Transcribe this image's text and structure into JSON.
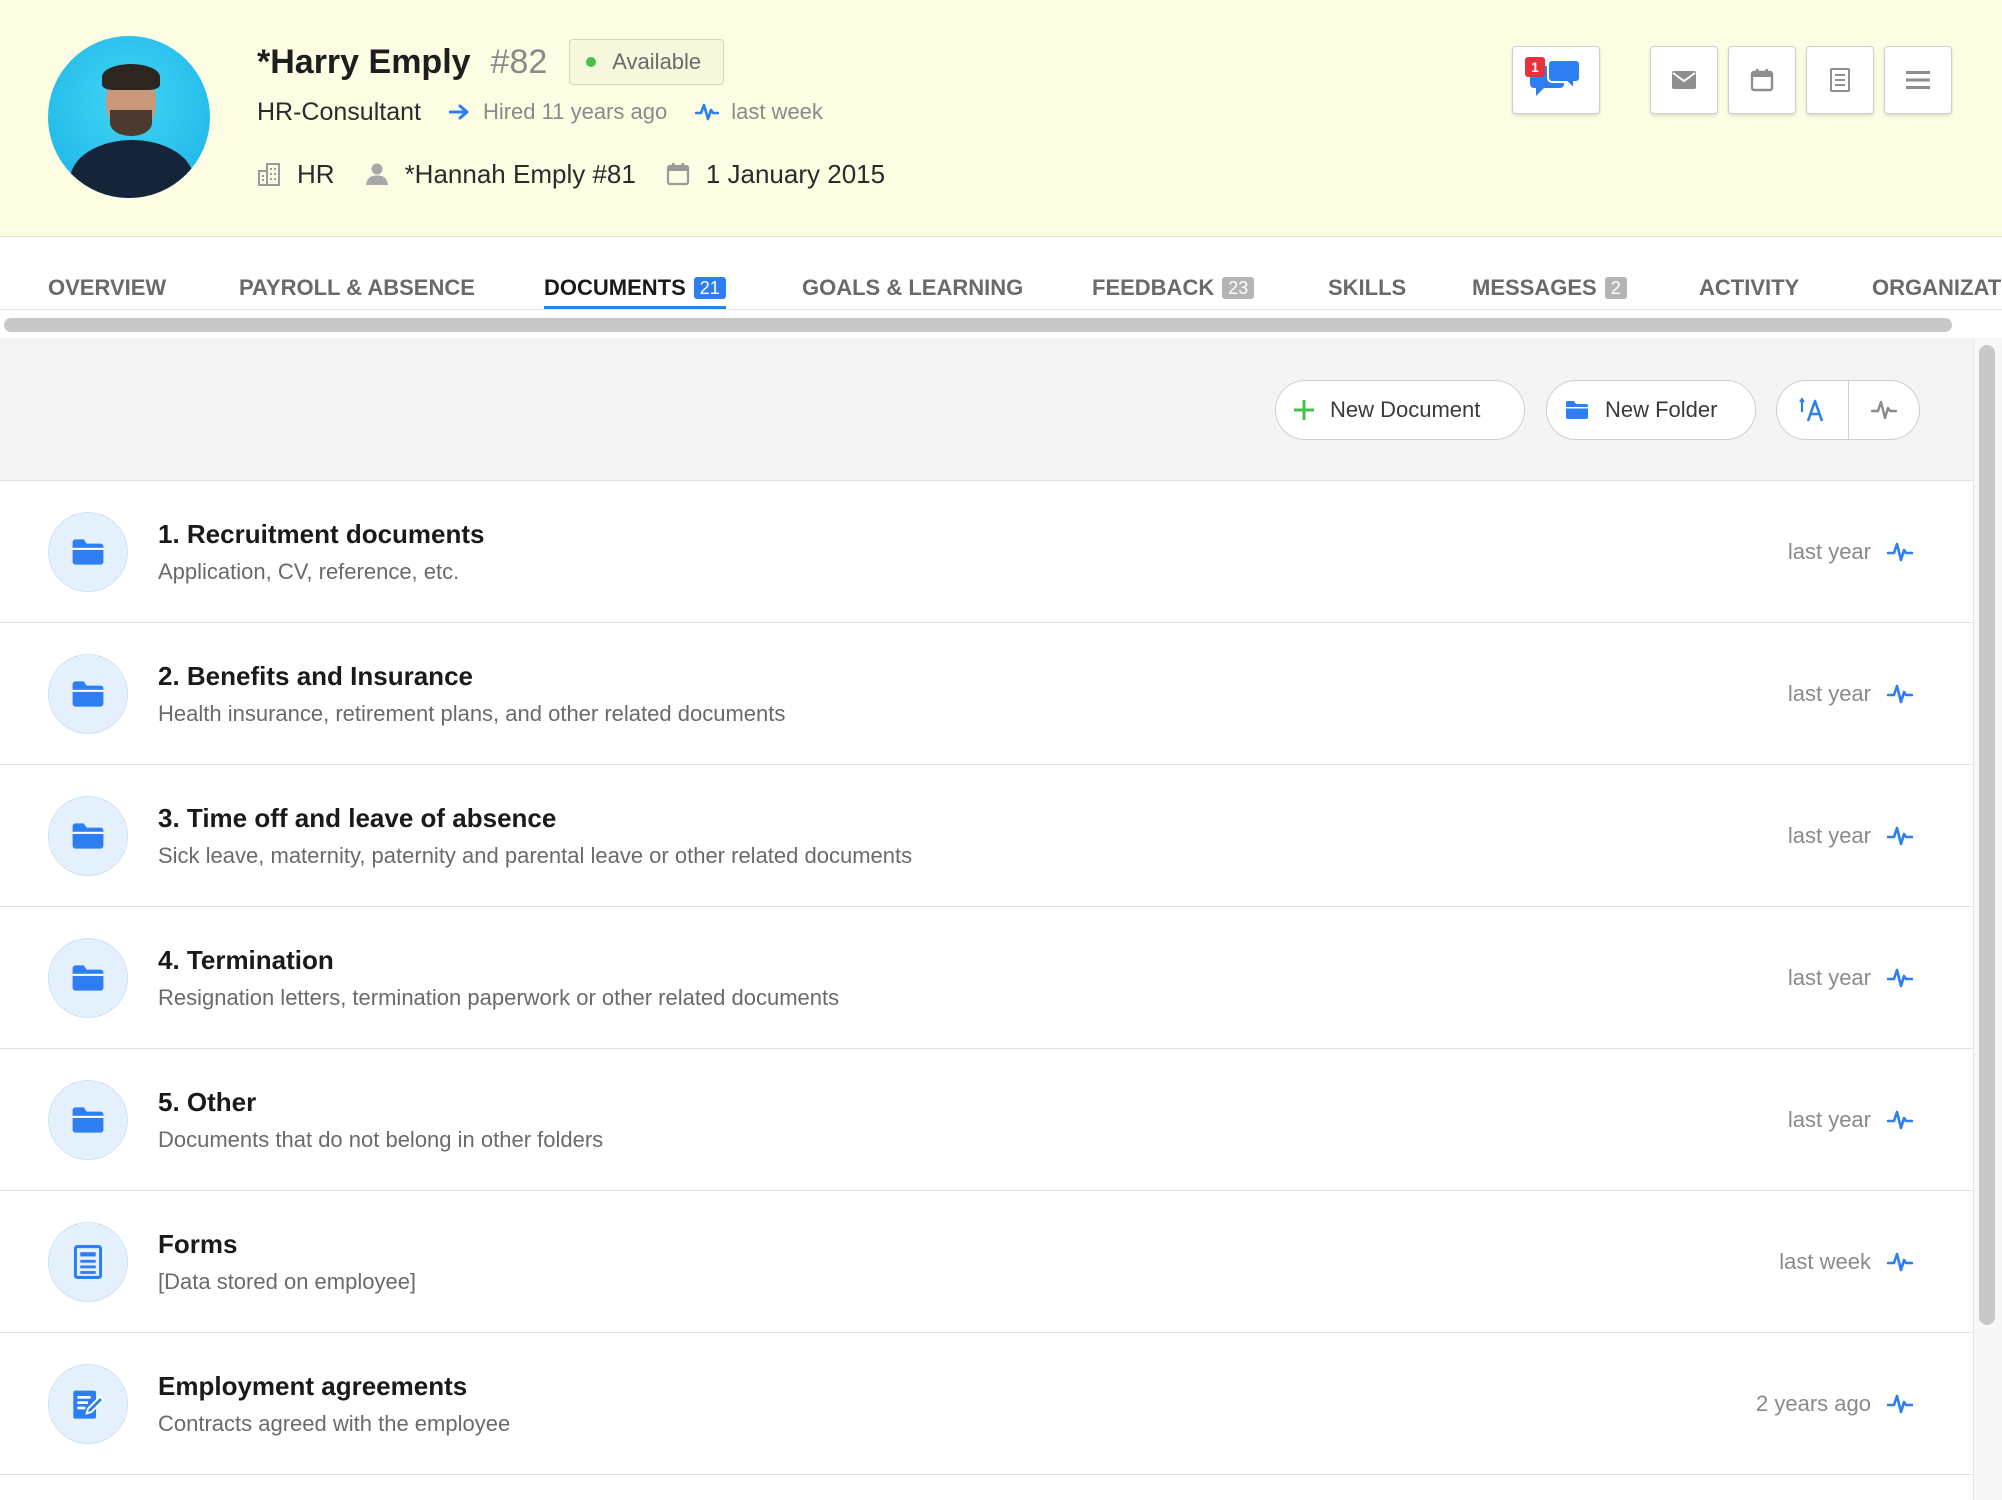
{
  "employee": {
    "name": "*Harry Emply",
    "number": "#82",
    "status": "Available",
    "status_color": "#47c04a",
    "role": "HR-Consultant",
    "hired": "Hired 11 years ago",
    "last_activity": "last week",
    "department": "HR",
    "manager": "*Hannah Emply #81",
    "start_date": "1 January 2015"
  },
  "header_actions": {
    "chat_badge": "1",
    "icons": [
      "chat-icon",
      "envelope-icon",
      "calendar-icon",
      "document-icon",
      "menu-icon"
    ]
  },
  "tabs": [
    {
      "label": "Overview",
      "count": null
    },
    {
      "label": "Payroll & Absence",
      "count": null
    },
    {
      "label": "Documents",
      "count": "21",
      "active": true
    },
    {
      "label": "Goals & Learning",
      "count": null
    },
    {
      "label": "Feedback",
      "count": "23"
    },
    {
      "label": "Skills",
      "count": null
    },
    {
      "label": "Messages",
      "count": "2"
    },
    {
      "label": "Activity",
      "count": null
    },
    {
      "label": "Organizat",
      "count": null
    }
  ],
  "toolbar": {
    "new_document": "New Document",
    "new_folder": "New Folder"
  },
  "documents": [
    {
      "title": "1. Recruitment documents",
      "subtitle": "Application, CV, reference, etc.",
      "time": "last year",
      "icon": "folder-icon"
    },
    {
      "title": "2. Benefits and Insurance",
      "subtitle": "Health insurance, retirement plans, and other related documents",
      "time": "last year",
      "icon": "folder-icon"
    },
    {
      "title": "3. Time off and leave of absence",
      "subtitle": "Sick leave, maternity, paternity and parental leave or other related documents",
      "time": "last year",
      "icon": "folder-icon"
    },
    {
      "title": "4. Termination",
      "subtitle": "Resignation letters, termination paperwork or other related documents",
      "time": "last year",
      "icon": "folder-icon"
    },
    {
      "title": "5. Other",
      "subtitle": "Documents that do not belong in other folders",
      "time": "last year",
      "icon": "folder-icon"
    },
    {
      "title": "Forms",
      "subtitle": "[Data stored on employee]",
      "time": "last week",
      "icon": "form-icon"
    },
    {
      "title": "Employment agreements",
      "subtitle": "Contracts agreed with the employee",
      "time": "2 years ago",
      "icon": "contract-edit-icon"
    }
  ],
  "colors": {
    "accent": "#2d7ff1",
    "header_bg": "#fdfde3",
    "badge_red": "#e8323c"
  }
}
